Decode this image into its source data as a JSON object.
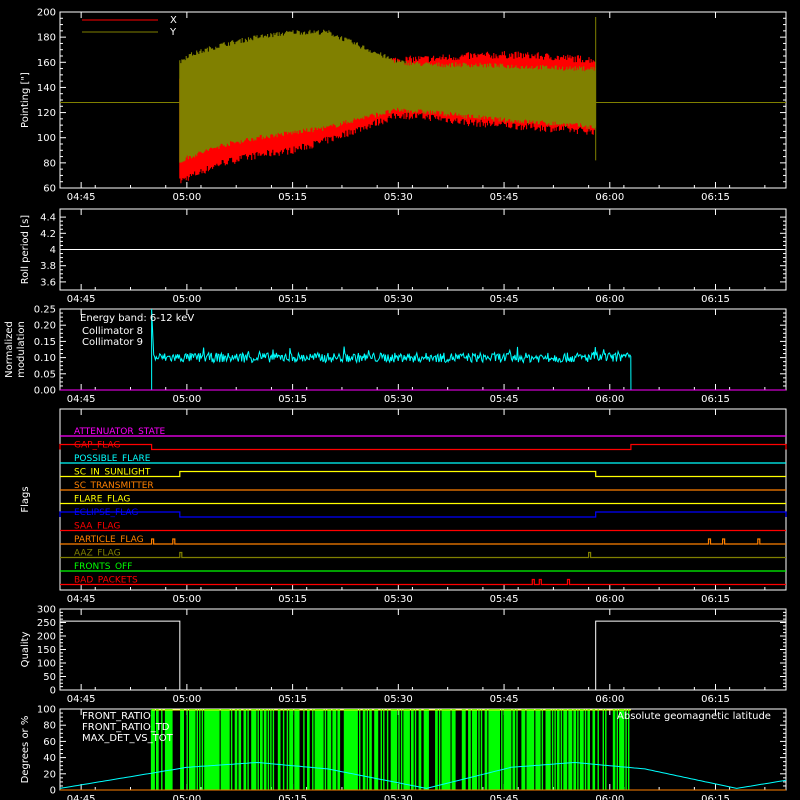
{
  "chart_data": [
    {
      "type": "line",
      "name": "pointing",
      "ylabel": "Pointing [\"]",
      "ylim": [
        60,
        200
      ],
      "yticks": [
        60,
        80,
        100,
        120,
        140,
        160,
        180,
        200
      ],
      "time_range": [
        "04:42",
        "06:25"
      ],
      "xticks": [
        "04:45",
        "05:00",
        "05:15",
        "05:30",
        "05:45",
        "06:00",
        "06:15"
      ],
      "series": [
        {
          "name": "X",
          "color": "#ff0000",
          "band": {
            "t": [
              "04:59",
              "05:00",
              "05:05",
              "05:10",
              "05:15",
              "05:20",
              "05:25",
              "05:30",
              "05:35",
              "05:40",
              "05:45",
              "05:50",
              "05:55",
              "05:58"
            ],
            "upper": [
              150,
              148,
              152,
              154,
              156,
              158,
              160,
              162,
              163,
              165,
              166,
              165,
              163,
              162
            ],
            "lower": [
              65,
              68,
              80,
              86,
              90,
              98,
              108,
              118,
              116,
              112,
              110,
              108,
              106,
              105
            ]
          }
        },
        {
          "name": "Y",
          "color": "#808000",
          "baseline": 128,
          "band": {
            "t": [
              "04:59",
              "05:00",
              "05:05",
              "05:10",
              "05:15",
              "05:20",
              "05:25",
              "05:30",
              "05:35",
              "05:40",
              "05:45",
              "05:50",
              "05:55",
              "05:58"
            ],
            "upper": [
              160,
              165,
              174,
              180,
              184,
              184,
              172,
              160,
              158,
              158,
              157,
              156,
              155,
              155
            ],
            "lower": [
              80,
              84,
              94,
              100,
              104,
              108,
              116,
              122,
              120,
              117,
              114,
              112,
              110,
              108
            ]
          }
        }
      ]
    },
    {
      "type": "line",
      "name": "roll-period",
      "ylabel": "Roll period [s]",
      "ylim": [
        3.5,
        4.5
      ],
      "yticks": [
        3.6,
        3.8,
        4.0,
        4.2,
        4.4
      ],
      "series": [
        {
          "name": "",
          "color": "#ffffff",
          "constant": 4.0
        }
      ]
    },
    {
      "type": "line",
      "name": "modulation",
      "ylabel": "Normalized modulation",
      "ylim": [
        0,
        0.25
      ],
      "yticks": [
        "0.00",
        "0.05",
        "0.10",
        "0.15",
        "0.20",
        "0.25"
      ],
      "annotation": "Energy band: 6-12 keV",
      "series": [
        {
          "name": "Collimator 8",
          "color": "#00ffff",
          "t_start": "04:55",
          "t_end": "06:03",
          "mean": 0.1,
          "spread": 0.015
        },
        {
          "name": "Collimator 9",
          "color": "#ff00ff",
          "constant": 0.0
        }
      ]
    },
    {
      "type": "line",
      "name": "flags",
      "ylabel": "Flags",
      "flags": [
        {
          "label": "ATTENUATOR_STATE",
          "color": "#ff00ff",
          "highs": []
        },
        {
          "label": "GAP_FLAG",
          "color": "#ff0000",
          "highs": [
            [
              "04:42",
              "04:55"
            ],
            [
              "06:03",
              "06:25"
            ]
          ]
        },
        {
          "label": "POSSIBLE_FLARE",
          "color": "#00ffff",
          "highs": []
        },
        {
          "label": "SC_IN_SUNLIGHT",
          "color": "#ffff00",
          "highs": [
            [
              "04:59",
              "05:58"
            ]
          ]
        },
        {
          "label": "SC_TRANSMITTER",
          "color": "#ff8000",
          "highs": []
        },
        {
          "label": "FLARE_FLAG",
          "color": "#ffff00",
          "highs": []
        },
        {
          "label": "ECLIPSE_FLAG",
          "color": "#0000ff",
          "highs": [
            [
              "04:42",
              "04:59"
            ],
            [
              "05:58",
              "06:25"
            ]
          ]
        },
        {
          "label": "SAA_FLAG",
          "color": "#ff0000",
          "highs": []
        },
        {
          "label": "PARTICLE_FLAG",
          "color": "#ff8000",
          "highs": [
            [
              "04:55",
              "04:55"
            ],
            [
              "04:58",
              "04:58"
            ],
            [
              "06:14",
              "06:14"
            ],
            [
              "06:16",
              "06:16"
            ],
            [
              "06:21",
              "06:21"
            ]
          ]
        },
        {
          "label": "AAZ_FLAG",
          "color": "#808000",
          "highs": [
            [
              "04:59",
              "04:59"
            ],
            [
              "05:57",
              "05:57"
            ]
          ]
        },
        {
          "label": "FRONTS_OFF",
          "color": "#00ff00",
          "highs": []
        },
        {
          "label": "BAD_PACKETS",
          "color": "#ff0000",
          "highs": [
            [
              "05:49",
              "05:49"
            ],
            [
              "05:50",
              "05:50"
            ],
            [
              "05:54",
              "05:54"
            ]
          ]
        }
      ]
    },
    {
      "type": "line",
      "name": "quality",
      "ylabel": "Quality",
      "ylim": [
        0,
        300
      ],
      "yticks": [
        0,
        50,
        100,
        150,
        200,
        250,
        300
      ],
      "series": [
        {
          "name": "",
          "color": "#ffffff",
          "segments": [
            [
              "04:42",
              "04:59",
              255
            ],
            [
              "04:59",
              "05:58",
              0
            ],
            [
              "05:58",
              "06:25",
              255
            ]
          ]
        }
      ]
    },
    {
      "type": "line",
      "name": "front-ratio",
      "ylabel": "Degrees or %",
      "ylim": [
        0,
        100
      ],
      "yticks": [
        0,
        20,
        40,
        60,
        80,
        100
      ],
      "annotation": "Absolute geomagnetic latitude",
      "series": [
        {
          "name": "FRONT_RATIO",
          "color": "#ffff00",
          "t_start": "04:55",
          "t_end": "06:03",
          "level": 100
        },
        {
          "name": "FRONT_RATIO_TD",
          "color": "#00ff00",
          "t_start": "04:55",
          "t_end": "06:03",
          "level": 100
        },
        {
          "name": "MAX_DET_VS_TOT",
          "color": "#ff8000",
          "constant": 0
        },
        {
          "name": "Absolute geomagnetic latitude",
          "color": "#00ffff",
          "t": [
            "04:42",
            "05:00",
            "05:10",
            "05:20",
            "05:34",
            "05:46",
            "05:55",
            "06:05",
            "06:18",
            "06:25"
          ],
          "values": [
            2,
            28,
            34,
            26,
            2,
            28,
            34,
            26,
            2,
            12
          ]
        }
      ]
    }
  ]
}
